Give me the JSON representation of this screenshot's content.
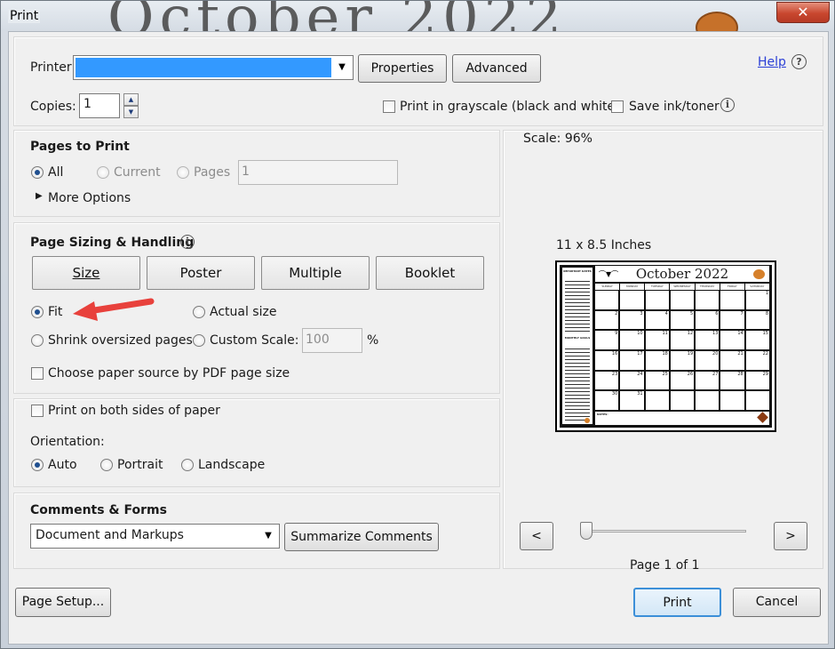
{
  "window": {
    "title": "Print",
    "close_glyph": "✕",
    "background_text": "October 2022"
  },
  "printer": {
    "label": "Printer:",
    "selected": "",
    "properties_label": "Properties",
    "advanced_label": "Advanced",
    "help_label": "Help",
    "copies_label": "Copies:",
    "copies_value": "1",
    "grayscale_label": "Print in grayscale (black and white)",
    "save_ink_label": "Save ink/toner",
    "accent": "#3399ff"
  },
  "pages_to_print": {
    "title": "Pages to Print",
    "all_label": "All",
    "current_label": "Current",
    "pages_label": "Pages",
    "pages_value": "1",
    "more_options_label": "More Options"
  },
  "sizing": {
    "title": "Page Sizing & Handling",
    "size_label": "Size",
    "poster_label": "Poster",
    "multiple_label": "Multiple",
    "booklet_label": "Booklet",
    "fit_label": "Fit",
    "actual_label": "Actual size",
    "shrink_label": "Shrink oversized pages",
    "custom_label": "Custom Scale:",
    "custom_value": "100",
    "percent": "%",
    "paper_source_label": "Choose paper source by PDF page size"
  },
  "orientation": {
    "both_sides_label": "Print on both sides of paper",
    "title": "Orientation:",
    "auto_label": "Auto",
    "portrait_label": "Portrait",
    "landscape_label": "Landscape"
  },
  "comments": {
    "title": "Comments & Forms",
    "selected": "Document and Markups",
    "summarize_label": "Summarize Comments"
  },
  "preview": {
    "scale_text": "Scale:  96%",
    "paper_text": "11 x 8.5 Inches",
    "calendar_title": "October 2022",
    "weekdays": [
      "SUNDAY",
      "MONDAY",
      "TUESDAY",
      "WEDNESDAY",
      "THURSDAY",
      "FRIDAY",
      "SATURDAY"
    ],
    "side_top": "IMPORTANT DATES",
    "side_mid": "MONTHLY GOALS",
    "notes_label": "NOTES:",
    "days": [
      "",
      "",
      "",
      "",
      "",
      "",
      "1",
      "2",
      "3",
      "4",
      "5",
      "6",
      "7",
      "8",
      "9",
      "10",
      "11",
      "12",
      "13",
      "14",
      "15",
      "16",
      "17",
      "18",
      "19",
      "20",
      "21",
      "22",
      "23",
      "24",
      "25",
      "26",
      "27",
      "28",
      "29",
      "30",
      "31",
      "",
      "",
      "",
      "",
      ""
    ],
    "prev_label": "<",
    "next_label": ">",
    "page_text": "Page 1 of 1",
    "slider_fraction": 0
  },
  "footer": {
    "page_setup_label": "Page Setup...",
    "print_label": "Print",
    "cancel_label": "Cancel"
  },
  "annotation": {
    "arrow_color": "#e8413c"
  }
}
